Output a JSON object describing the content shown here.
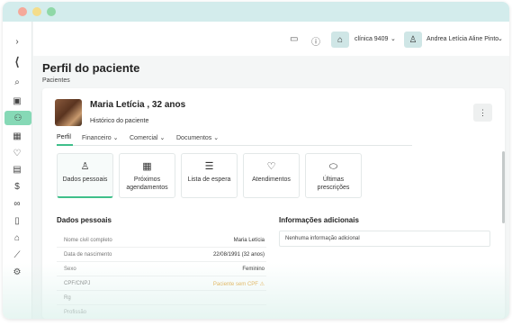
{
  "window": {
    "controls": [
      "close",
      "minimize",
      "maximize"
    ]
  },
  "sidebar": {
    "items": [
      {
        "icon": "chevron-right-icon",
        "glyph": "›"
      },
      {
        "icon": "logo-icon",
        "glyph": "⟨"
      },
      {
        "icon": "search-icon",
        "glyph": "⌕"
      },
      {
        "icon": "dashboard-icon",
        "glyph": "▣"
      },
      {
        "icon": "patients-icon",
        "glyph": "⚇",
        "active": true
      },
      {
        "icon": "calendar-icon",
        "glyph": "▦"
      },
      {
        "icon": "stethoscope-icon",
        "glyph": "♡"
      },
      {
        "icon": "inventory-icon",
        "glyph": "▤"
      },
      {
        "icon": "dollar-icon",
        "glyph": "$"
      },
      {
        "icon": "handshake-icon",
        "glyph": "∞"
      },
      {
        "icon": "document-icon",
        "glyph": "▯"
      },
      {
        "icon": "store-icon",
        "glyph": "⌂"
      },
      {
        "icon": "chart-icon",
        "glyph": "⟋"
      },
      {
        "icon": "settings-icon",
        "glyph": "⚙"
      }
    ]
  },
  "topbar": {
    "clinic_name": "clínica 9409",
    "user_name": "Andrea Letícia Aline Pinto"
  },
  "page": {
    "title": "Perfil do paciente",
    "breadcrumb": "Pacientes"
  },
  "patient": {
    "name": "Maria Letícia , 32 anos",
    "history_link": "Histórico do paciente"
  },
  "tabs": [
    {
      "label": "Perfil",
      "active": true
    },
    {
      "label": "Financeiro",
      "dropdown": true
    },
    {
      "label": "Comercial",
      "dropdown": true
    },
    {
      "label": "Documentos",
      "dropdown": true
    }
  ],
  "quick_actions": [
    {
      "label": "Dados pessoais",
      "icon": "user-icon",
      "glyph": "♙",
      "active": true
    },
    {
      "label": "Próximos agendamentos",
      "icon": "calendar-icon",
      "glyph": "▦"
    },
    {
      "label": "Lista de espera",
      "icon": "list-icon",
      "glyph": "☰"
    },
    {
      "label": "Atendimentos",
      "icon": "stethoscope-icon",
      "glyph": "♡"
    },
    {
      "label": "Últimas prescrições",
      "icon": "pills-icon",
      "glyph": "⬭"
    }
  ],
  "personal_data": {
    "title": "Dados pessoais",
    "rows": [
      {
        "label": "Nome civil completo",
        "value": "Maria Letícia"
      },
      {
        "label": "Data de nascimento",
        "value": "22/08/1991 (32 anos)"
      },
      {
        "label": "Sexo",
        "value": "Feminino"
      },
      {
        "label": "CPF/CNPJ",
        "value": "Paciente sem CPF ⚠",
        "warning": true
      },
      {
        "label": "Rg",
        "value": ""
      },
      {
        "label": "Profissão",
        "value": ""
      }
    ]
  },
  "additional_info": {
    "title": "Informações adicionais",
    "text": "Nenhuma informação adicional"
  },
  "colors": {
    "accent": "#3fbf8a",
    "active_sidebar": "#86d9b6",
    "titlebar": "#d3ecec",
    "warning": "#e3a63a"
  }
}
